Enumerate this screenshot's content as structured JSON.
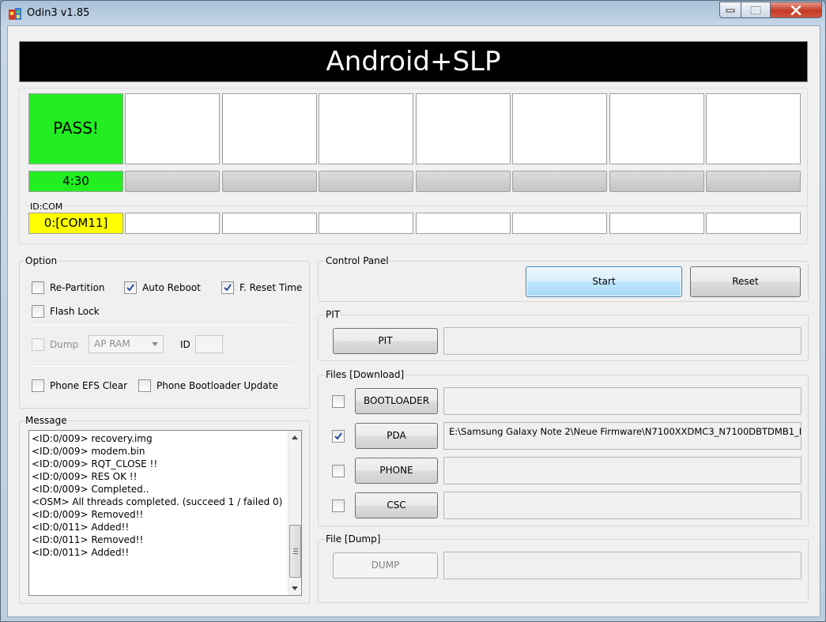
{
  "window": {
    "title": "Odin3 v1.85"
  },
  "banner": {
    "text": "Android+SLP"
  },
  "slots": {
    "first_status": "PASS!",
    "first_time": "4:30",
    "id_com_label": "ID:COM",
    "first_com": "0:[COM11]"
  },
  "option": {
    "label": "Option",
    "re_partition": {
      "label": "Re-Partition",
      "checked": false
    },
    "auto_reboot": {
      "label": "Auto Reboot",
      "checked": true
    },
    "f_reset_time": {
      "label": "F. Reset Time",
      "checked": true
    },
    "flash_lock": {
      "label": "Flash Lock",
      "checked": false
    },
    "dump": {
      "label": "Dump",
      "checked": false
    },
    "dump_select": "AP RAM",
    "id_label": "ID",
    "phone_efs_clear": {
      "label": "Phone EFS Clear",
      "checked": false
    },
    "phone_bootloader_update": {
      "label": "Phone Bootloader Update",
      "checked": false
    }
  },
  "message": {
    "label": "Message",
    "lines": [
      "<ID:0/009> recovery.img",
      "<ID:0/009> modem.bin",
      "<ID:0/009> RQT_CLOSE !!",
      "<ID:0/009> RES OK !!",
      "<ID:0/009> Completed..",
      "<OSM> All threads completed. (succeed 1 / failed 0)",
      "<ID:0/009> Removed!!",
      "<ID:0/011> Added!!",
      "<ID:0/011> Removed!!",
      "<ID:0/011> Added!!"
    ]
  },
  "control_panel": {
    "label": "Control Panel",
    "start": "Start",
    "reset": "Reset"
  },
  "pit": {
    "label": "PIT",
    "button": "PIT"
  },
  "files": {
    "label": "Files [Download]",
    "bootloader": {
      "button": "BOOTLOADER",
      "checked": false,
      "path": ""
    },
    "pda": {
      "button": "PDA",
      "checked": true,
      "path": "E:\\Samsung Galaxy Note 2\\Neue Firmware\\N7100XXDMC3_N7100DBTDMB1_N"
    },
    "phone": {
      "button": "PHONE",
      "checked": false,
      "path": ""
    },
    "csc": {
      "button": "CSC",
      "checked": false,
      "path": ""
    }
  },
  "file_dump": {
    "label": "File [Dump]",
    "button": "DUMP"
  }
}
